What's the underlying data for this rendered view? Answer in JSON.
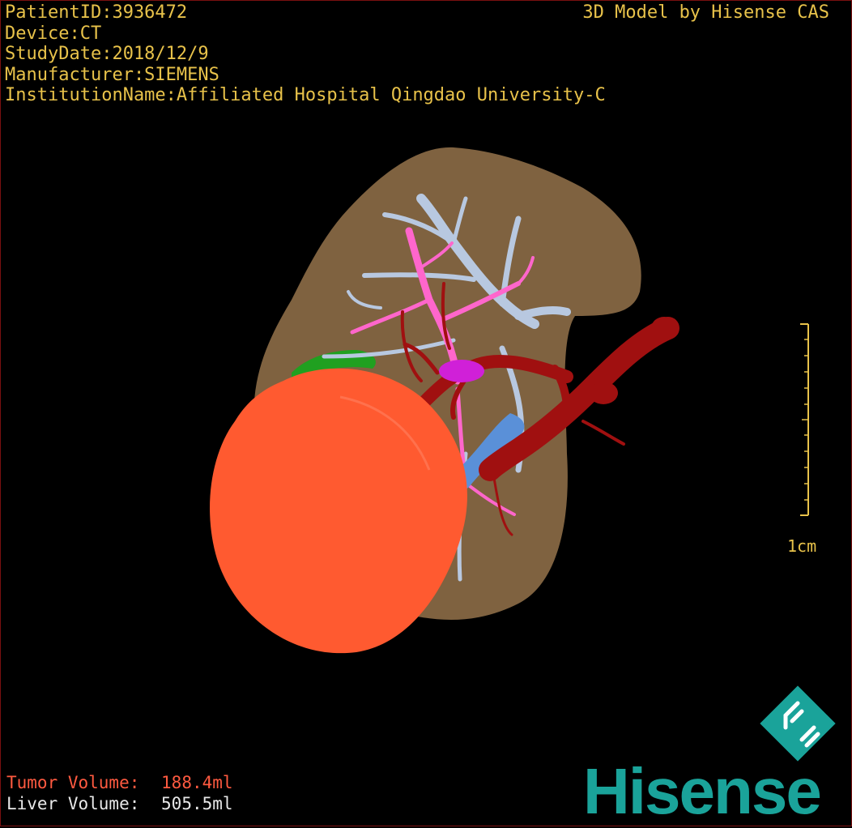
{
  "patient_info": {
    "patient_id": "PatientID:3936472",
    "device": "Device:CT",
    "study_date": "StudyDate:2018/12/9",
    "manufacturer": "Manufacturer:SIEMENS",
    "institution": "InstitutionName:Affiliated Hospital Qingdao University-C"
  },
  "header": {
    "model_credit": "3D Model by Hisense CAS"
  },
  "scale_bar": {
    "label": "1cm"
  },
  "volumes": {
    "tumor_label": "Tumor Volume:",
    "tumor_value": "188.4ml",
    "liver_label": "Liver Volume:",
    "liver_value": "505.5ml"
  },
  "brand": {
    "logo_text": "Hisense"
  },
  "colors": {
    "text": "#e8c24a",
    "liver": "#8a6a45",
    "tumor": "#ff5a30",
    "hepatic_vein": "#b8c8e0",
    "portal_vein": "#ff66cc",
    "artery": "#a01010",
    "vena_cava": "#5a90d8",
    "gallbladder": "#20a020",
    "brand": "#1aa39a"
  }
}
